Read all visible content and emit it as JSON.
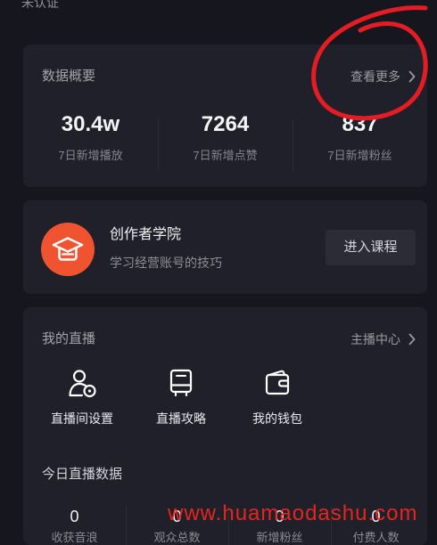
{
  "colors": {
    "background": "#15161e",
    "card": "#1f2029",
    "accent": "#ef5330",
    "annotation": "#e41d24",
    "watermark": "#e5251f"
  },
  "header": {
    "status": "未认证"
  },
  "overview": {
    "title": "数据概要",
    "more": "查看更多",
    "more_icon": "chevron-right-icon",
    "stats": [
      {
        "value": "30.4w",
        "label": "7日新增播放"
      },
      {
        "value": "7264",
        "label": "7日新增点赞"
      },
      {
        "value": "837",
        "label": "7日新增粉丝"
      }
    ]
  },
  "academy": {
    "icon": "graduation-cap-icon",
    "title": "创作者学院",
    "subtitle": "学习经营账号的技巧",
    "button": "进入课程"
  },
  "live": {
    "title": "我的直播",
    "more": "主播中心",
    "more_icon": "chevron-right-icon",
    "actions": [
      {
        "label": "直播间设置",
        "icon": "user-settings-icon"
      },
      {
        "label": "直播攻略",
        "icon": "guide-icon"
      },
      {
        "label": "我的钱包",
        "icon": "wallet-icon"
      }
    ],
    "today_title": "今日直播数据",
    "today_stats": [
      {
        "value": "0",
        "label": "收获音浪"
      },
      {
        "value": "0",
        "label": "观众总数"
      },
      {
        "value": "0",
        "label": "新增粉丝"
      },
      {
        "value": "0",
        "label": "付费人数"
      }
    ]
  },
  "watermark": "www.huamaodashu.com"
}
